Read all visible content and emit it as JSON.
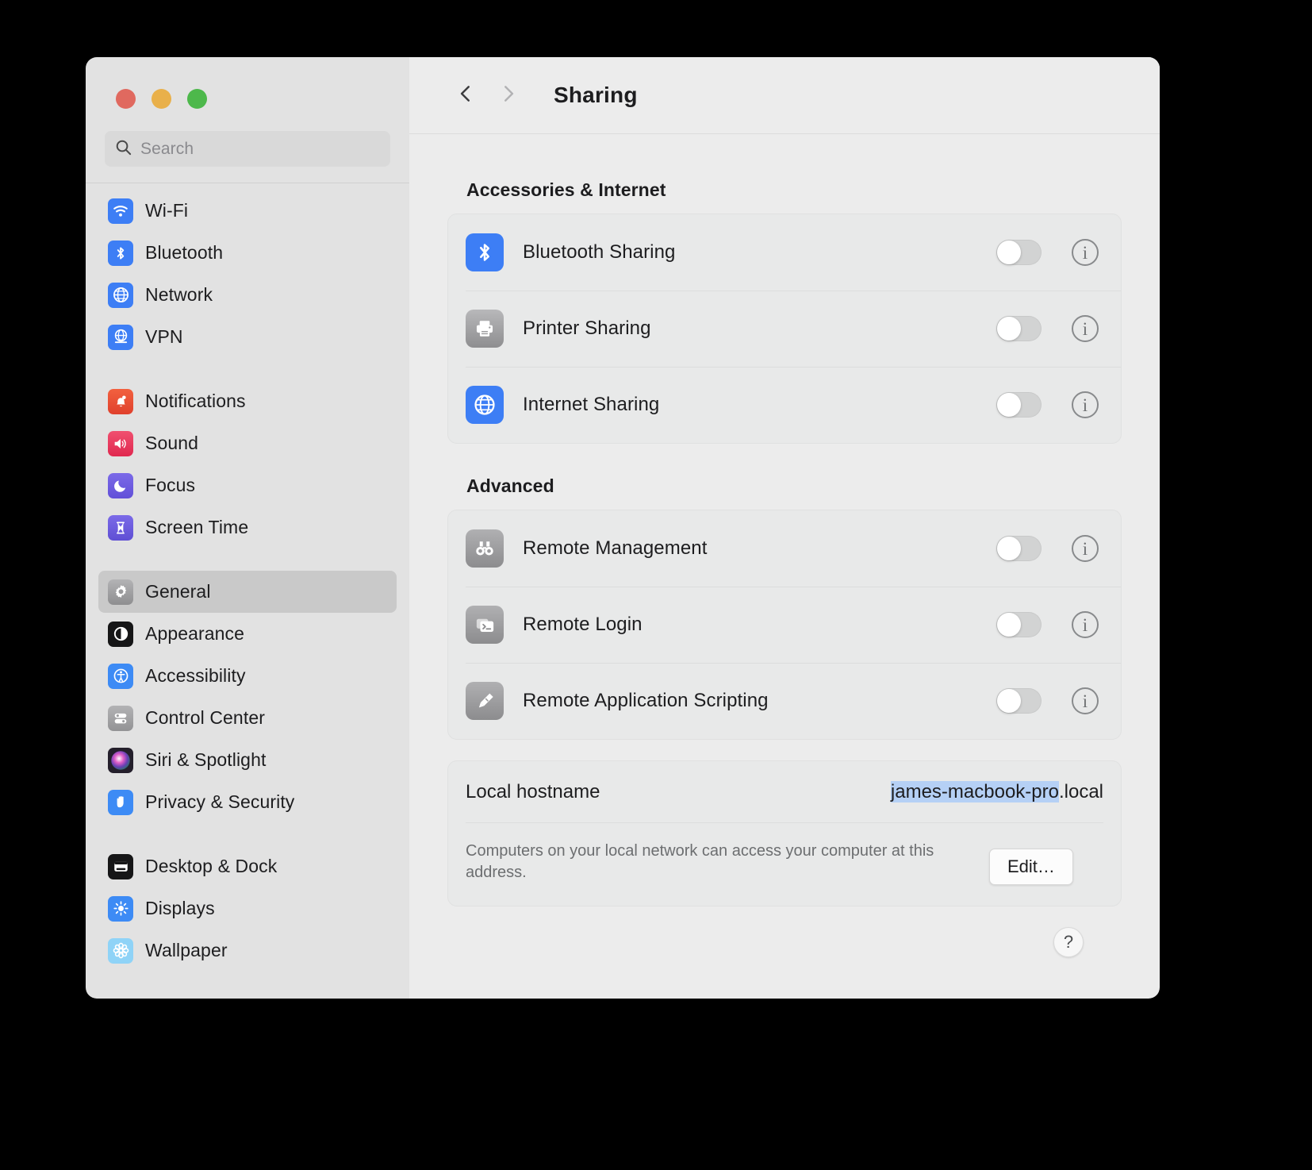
{
  "window": {
    "traffic_lights": [
      "close",
      "minimize",
      "zoom"
    ],
    "colors": {
      "close": "#e0695f",
      "minimize": "#e9b04a",
      "zoom": "#4db84b",
      "accent": "#3a7bf0",
      "selection": "#b5d0f5"
    }
  },
  "search": {
    "placeholder": "Search",
    "value": "",
    "icon": "search-icon"
  },
  "sidebar": {
    "groups": [
      {
        "items": [
          {
            "label": "Wi-Fi",
            "icon": "wifi-icon",
            "selected": false
          },
          {
            "label": "Bluetooth",
            "icon": "bluetooth-icon",
            "selected": false
          },
          {
            "label": "Network",
            "icon": "globe-icon",
            "selected": false
          },
          {
            "label": "VPN",
            "icon": "vpn-globe-icon",
            "selected": false
          }
        ]
      },
      {
        "items": [
          {
            "label": "Notifications",
            "icon": "bell-icon",
            "selected": false
          },
          {
            "label": "Sound",
            "icon": "speaker-icon",
            "selected": false
          },
          {
            "label": "Focus",
            "icon": "moon-icon",
            "selected": false
          },
          {
            "label": "Screen Time",
            "icon": "hourglass-icon",
            "selected": false
          }
        ]
      },
      {
        "items": [
          {
            "label": "General",
            "icon": "gear-icon",
            "selected": true
          },
          {
            "label": "Appearance",
            "icon": "appearance-icon",
            "selected": false
          },
          {
            "label": "Accessibility",
            "icon": "accessibility-icon",
            "selected": false
          },
          {
            "label": "Control Center",
            "icon": "control-center-icon",
            "selected": false
          },
          {
            "label": "Siri & Spotlight",
            "icon": "siri-icon",
            "selected": false
          },
          {
            "label": "Privacy & Security",
            "icon": "hand-icon",
            "selected": false
          }
        ]
      },
      {
        "items": [
          {
            "label": "Desktop & Dock",
            "icon": "desktop-dock-icon",
            "selected": false
          },
          {
            "label": "Displays",
            "icon": "brightness-icon",
            "selected": false
          },
          {
            "label": "Wallpaper",
            "icon": "wallpaper-icon",
            "selected": false
          }
        ]
      }
    ]
  },
  "header": {
    "title": "Sharing",
    "back_icon": "chevron-left-icon",
    "forward_icon": "chevron-right-icon",
    "back_enabled": true,
    "forward_enabled": false
  },
  "sections": [
    {
      "title": "Accessories & Internet",
      "rows": [
        {
          "label": "Bluetooth Sharing",
          "icon": "bluetooth-icon",
          "toggle": "off",
          "info": "i"
        },
        {
          "label": "Printer Sharing",
          "icon": "printer-icon",
          "toggle": "off",
          "info": "i"
        },
        {
          "label": "Internet Sharing",
          "icon": "globe-icon",
          "toggle": "off",
          "info": "i"
        }
      ]
    },
    {
      "title": "Advanced",
      "rows": [
        {
          "label": "Remote Management",
          "icon": "binoculars-icon",
          "toggle": "off",
          "info": "i"
        },
        {
          "label": "Remote Login",
          "icon": "terminal-icon",
          "toggle": "off",
          "info": "i"
        },
        {
          "label": "Remote Application Scripting",
          "icon": "script-icon",
          "toggle": "off",
          "info": "i"
        }
      ]
    }
  ],
  "hostname": {
    "label": "Local hostname",
    "value_selected": "james-macbook-pro",
    "value_rest": ".local",
    "description": "Computers on your local network can access your computer at this address.",
    "edit_label": "Edit…"
  },
  "help": {
    "label": "?"
  }
}
